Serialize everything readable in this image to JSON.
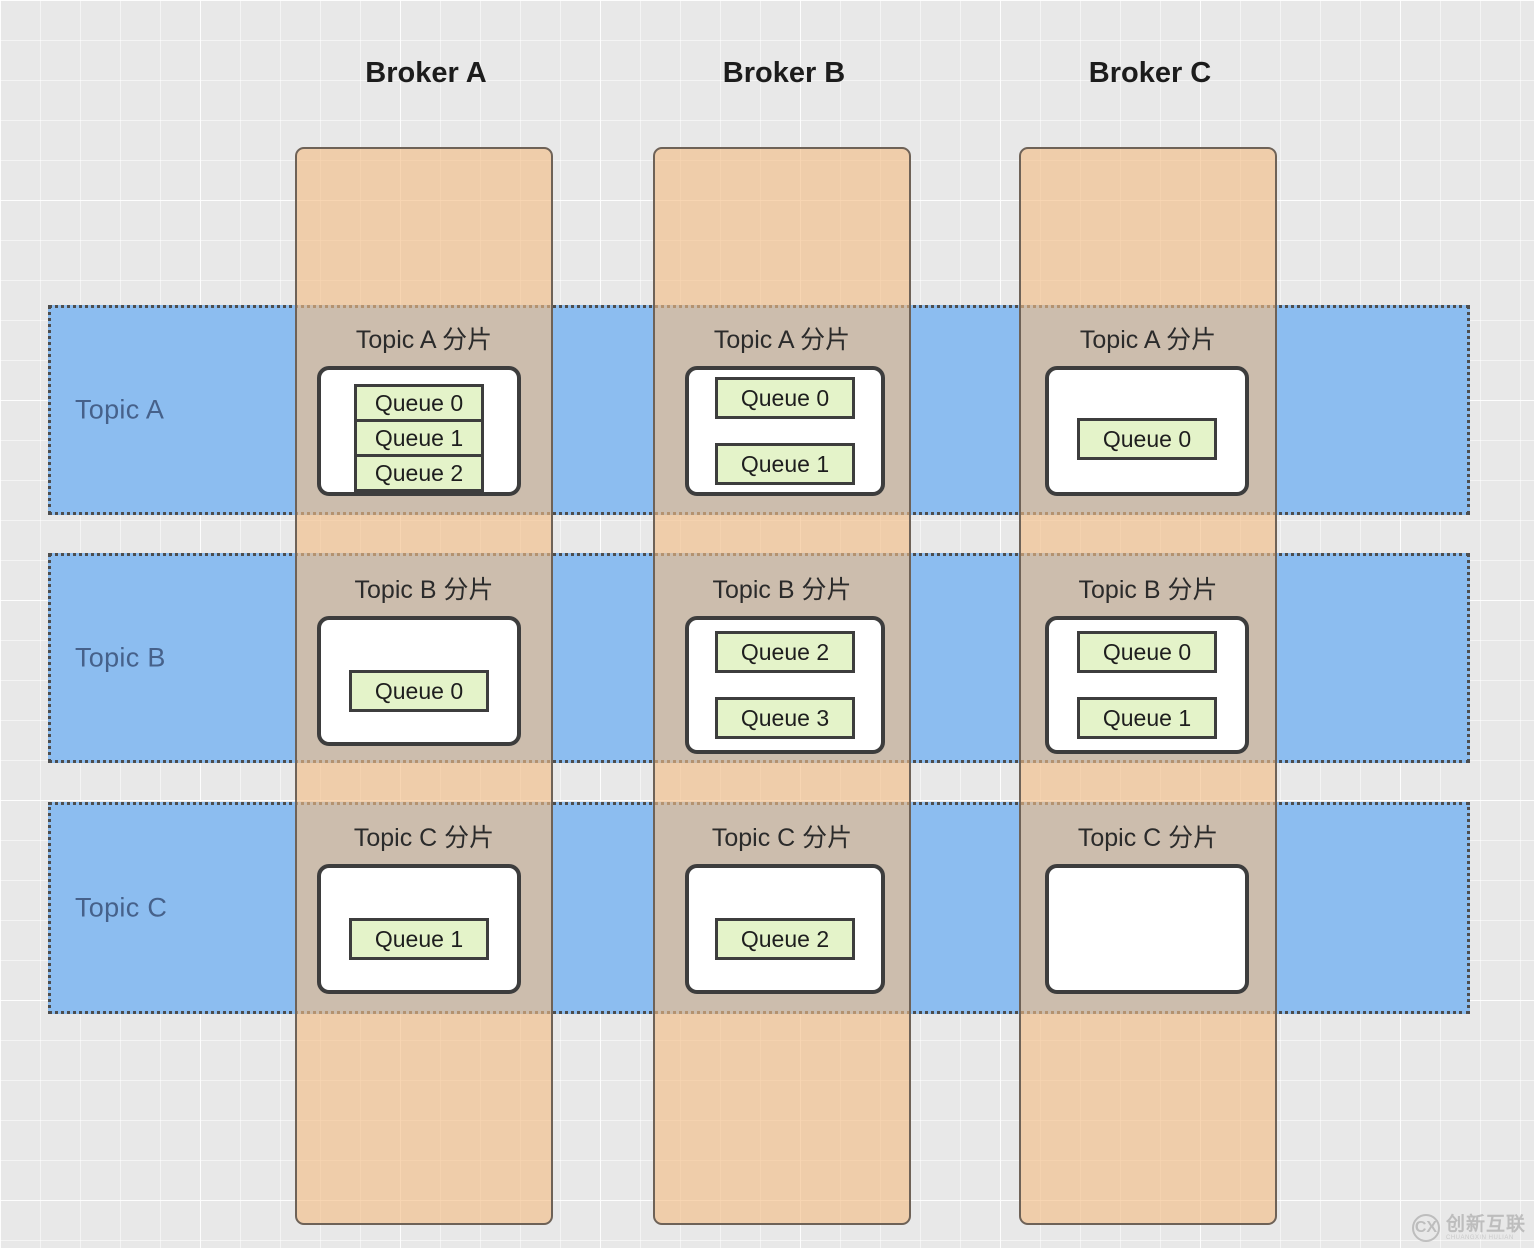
{
  "diagram": {
    "title_row": {
      "brokers": [
        {
          "label": "Broker A"
        },
        {
          "label": "Broker B"
        },
        {
          "label": "Broker C"
        }
      ]
    },
    "topics": [
      {
        "label": "Topic A"
      },
      {
        "label": "Topic B"
      },
      {
        "label": "Topic C"
      }
    ],
    "shards": [
      {
        "topic": "Topic A",
        "broker": "Broker A",
        "title": "Topic A 分片",
        "queues": [
          {
            "label": "Queue 0"
          },
          {
            "label": "Queue 1"
          },
          {
            "label": "Queue 2"
          }
        ]
      },
      {
        "topic": "Topic A",
        "broker": "Broker B",
        "title": "Topic A 分片",
        "queues": [
          {
            "label": "Queue 0"
          },
          {
            "label": "Queue 1"
          }
        ]
      },
      {
        "topic": "Topic A",
        "broker": "Broker C",
        "title": "Topic A 分片",
        "queues": [
          {
            "label": "Queue 0"
          }
        ]
      },
      {
        "topic": "Topic B",
        "broker": "Broker A",
        "title": "Topic B 分片",
        "queues": [
          {
            "label": "Queue 0"
          }
        ]
      },
      {
        "topic": "Topic B",
        "broker": "Broker B",
        "title": "Topic B 分片",
        "queues": [
          {
            "label": "Queue 2"
          },
          {
            "label": "Queue 3"
          }
        ]
      },
      {
        "topic": "Topic B",
        "broker": "Broker C",
        "title": "Topic B 分片",
        "queues": [
          {
            "label": "Queue 0"
          },
          {
            "label": "Queue 1"
          }
        ]
      },
      {
        "topic": "Topic C",
        "broker": "Broker A",
        "title": "Topic C 分片",
        "queues": [
          {
            "label": "Queue 1"
          }
        ]
      },
      {
        "topic": "Topic C",
        "broker": "Broker B",
        "title": "Topic C 分片",
        "queues": [
          {
            "label": "Queue 2"
          }
        ]
      },
      {
        "topic": "Topic C",
        "broker": "Broker C",
        "title": "Topic C 分片",
        "queues": []
      }
    ],
    "watermark": {
      "logo_glyph": "CX",
      "main_text": "创新互联",
      "sub_text": "CHUANGXIN HULIAN"
    },
    "colors": {
      "broker_fill": "#f3bd84",
      "topic_band_fill": "#8cbdf0",
      "queue_fill": "#e4f3c9",
      "shard_box_fill": "#ffffff",
      "border_dark": "#3d3d3d",
      "topic_label_text": "#46618a",
      "canvas_bg": "#e8e8e8"
    }
  }
}
